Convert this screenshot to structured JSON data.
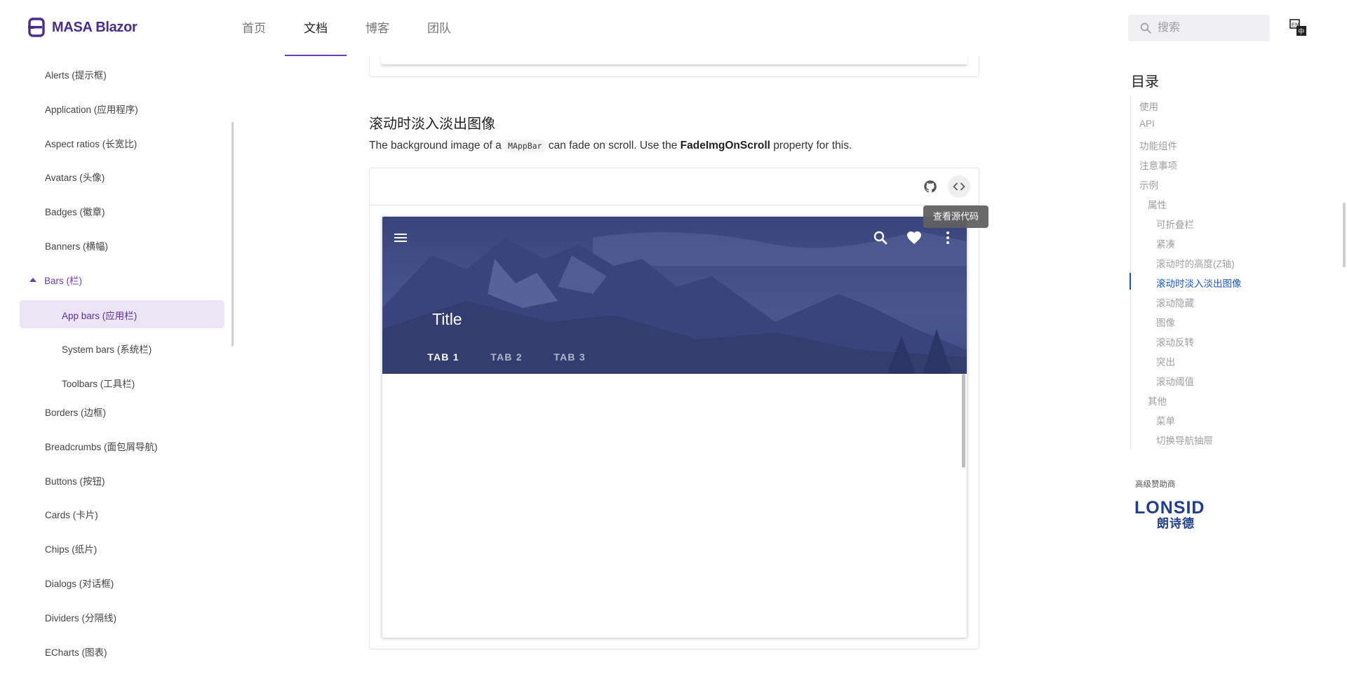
{
  "header": {
    "logo_text": "MASA Blazor",
    "nav": [
      "首页",
      "文档",
      "博客",
      "团队"
    ],
    "active_nav": "文档",
    "search_placeholder": "搜索"
  },
  "sidebar": {
    "items": [
      "Alerts (提示框)",
      "Application (应用程序)",
      "Aspect ratios (长宽比)",
      "Avatars (头像)",
      "Badges (徽章)",
      "Banners (横幅)"
    ],
    "group": "Bars (栏)",
    "group_items": [
      "App bars (应用栏)",
      "System bars (系统栏)",
      "Toolbars (工具栏)"
    ],
    "items_after": [
      "Borders (边框)",
      "Breadcrumbs (面包屑导航)",
      "Buttons (按钮)",
      "Cards (卡片)",
      "Chips (纸片)",
      "Dialogs (对话框)",
      "Dividers (分隔线)",
      "ECharts (图表)"
    ]
  },
  "main": {
    "section_title": "滚动时淡入淡出图像",
    "desc_pre": "The background image of a",
    "desc_code": "MAppBar",
    "desc_mid": "can fade on scroll. Use the",
    "desc_bold": "FadeImgOnScroll",
    "desc_post": "property for this.",
    "tooltip": "查看源代码",
    "demo": {
      "title": "Title",
      "tabs": [
        "TAB 1",
        "TAB 2",
        "TAB 3"
      ],
      "active_tab": "TAB 1"
    }
  },
  "toc": {
    "title": "目录",
    "items": [
      "使用",
      "API",
      "功能组件",
      "注意事项",
      "示例",
      "属性",
      "可折叠栏",
      "紧凑",
      "滚动时的高度(Z轴)",
      "滚动时淡入淡出图像",
      "滚动隐藏",
      "图像",
      "滚动反转",
      "突出",
      "滚动阈值",
      "其他",
      "菜单",
      "切换导航抽屉"
    ],
    "active": "滚动时淡入淡出图像"
  },
  "sponsor": {
    "label": "高级赞助商",
    "logo_en": "LONSID",
    "logo_cn": "朗诗德"
  },
  "colors": {
    "brand": "#4a2c91",
    "accent_purple": "#6a3bb6",
    "toc_active": "#1a56c8"
  }
}
